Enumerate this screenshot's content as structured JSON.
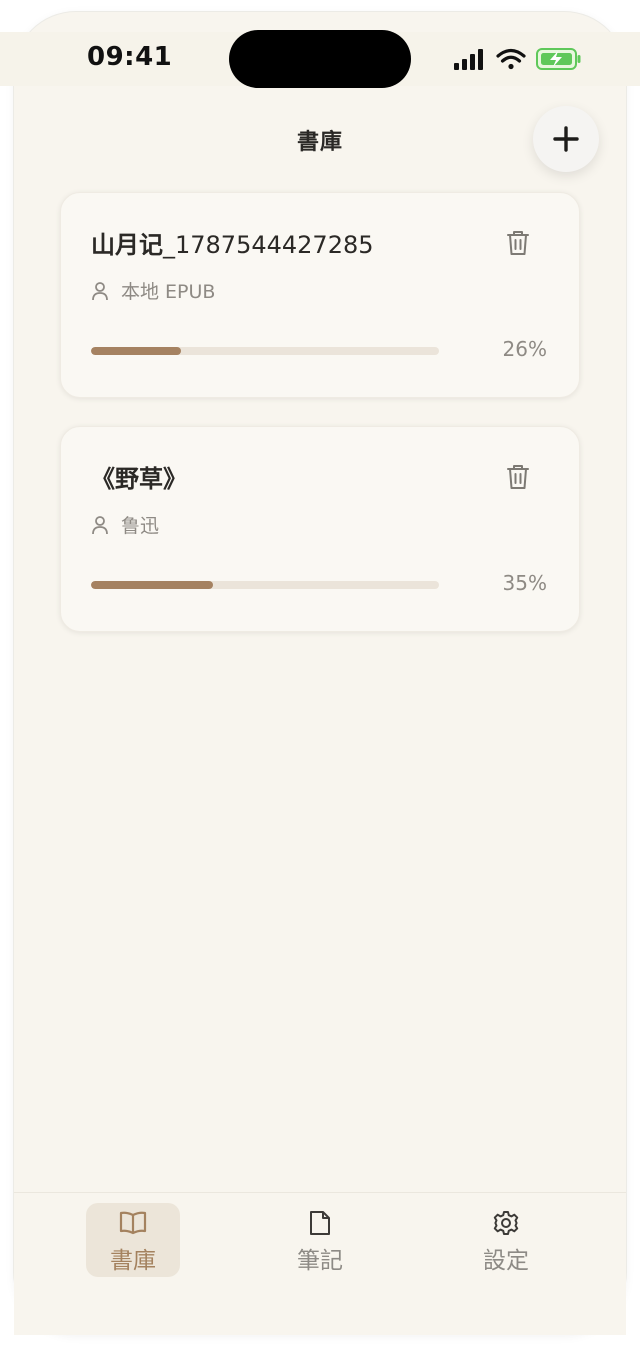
{
  "status_bar": {
    "time": "09:41",
    "icons": [
      "signal-icon",
      "wifi-icon",
      "battery-charging-icon"
    ]
  },
  "header": {
    "title": "書庫",
    "add_icon": "plus-icon"
  },
  "books": [
    {
      "title_main": "山月记",
      "title_suffix": "_1787544427285",
      "author": "本地 EPUB",
      "progress_text": "26%",
      "progress": 0.26
    },
    {
      "title_main": "《野草》",
      "title_suffix": "",
      "author": "鲁迅",
      "progress_text": "35%",
      "progress": 0.35
    }
  ],
  "tabs": [
    {
      "label": "書庫",
      "icon": "book-open-icon",
      "active": true
    },
    {
      "label": "筆記",
      "icon": "document-icon",
      "active": false
    },
    {
      "label": "設定",
      "icon": "gear-icon",
      "active": false
    }
  ],
  "colors": {
    "background": "#f8f5ee",
    "accent": "#a58261",
    "track": "#ebe4da",
    "text_primary": "#2b2926",
    "text_secondary": "#8e8a84"
  }
}
